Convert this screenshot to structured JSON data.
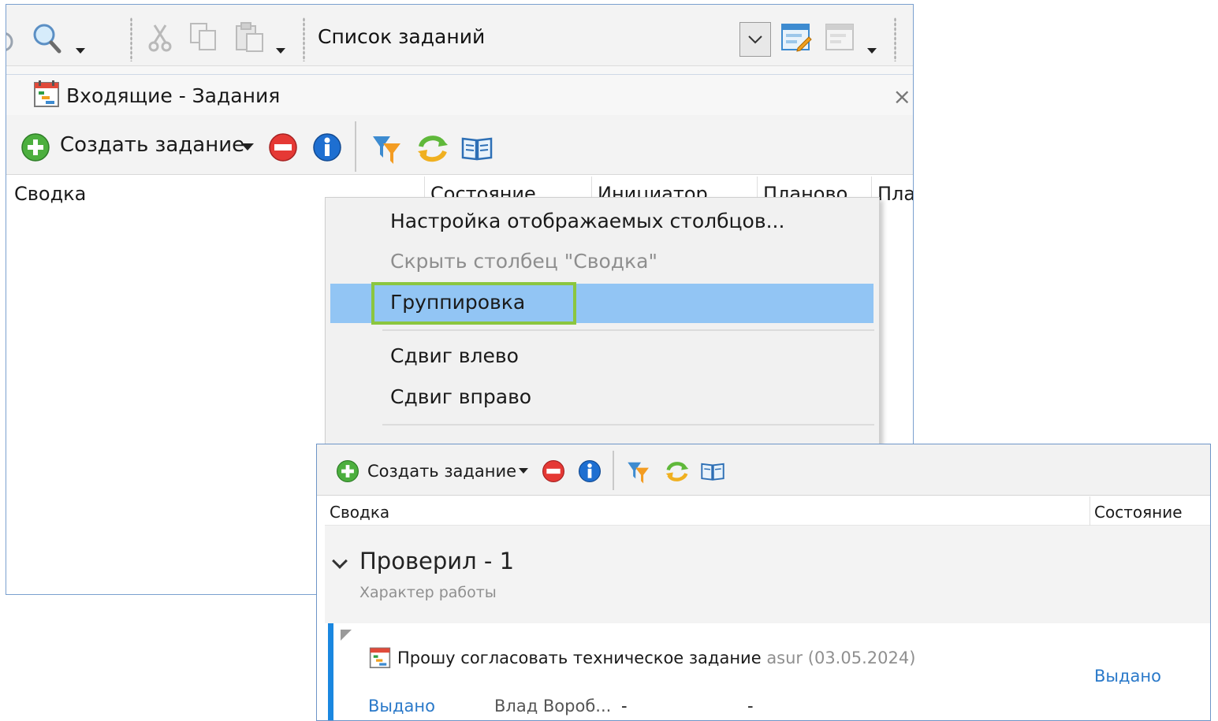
{
  "main_toolbar": {
    "list_selector_value": "Список заданий"
  },
  "tab": {
    "title": "Входящие - Задания",
    "close_glyph": "×"
  },
  "actions": {
    "create_task_label": "Создать задание"
  },
  "table_a": {
    "columns": [
      "Сводка",
      "Состояние",
      "Инициатор",
      "Планово",
      "Пла"
    ]
  },
  "context_menu": {
    "items": [
      {
        "label": "Настройка отображаемых столбцов...",
        "enabled": true
      },
      {
        "label": "Скрыть столбец \"Сводка\"",
        "enabled": false
      },
      {
        "label": "Группировка",
        "enabled": true,
        "highlighted": true
      },
      {
        "label": "Сдвиг влево",
        "enabled": true
      },
      {
        "label": "Сдвиг вправо",
        "enabled": true
      }
    ]
  },
  "front_window": {
    "create_task_label": "Создать задание",
    "columns": [
      "Сводка",
      "Состояние"
    ],
    "group": {
      "title": "Проверил - 1",
      "subtitle": "Характер работы"
    },
    "row": {
      "summary": "Прошу согласовать техническое задание",
      "author": "asur",
      "date": "(03.05.2024)",
      "status": "Выдано",
      "status_left": "Выдано",
      "initiator": "Влад Вороб...",
      "dash1": "-",
      "dash2": "-"
    }
  },
  "colors": {
    "window_border": "#7aa0cf",
    "menu_highlight": "#92c5f4",
    "callout_green": "#8bc63f",
    "row_accent": "#1a87e0",
    "link_blue": "#2a79c9"
  },
  "icons": [
    "search-icon",
    "cut-icon",
    "copy-icon",
    "paste-icon",
    "view-edit-icon",
    "view-icon",
    "calendar-task-icon",
    "add-icon",
    "delete-icon",
    "info-icon",
    "filter-icon",
    "refresh-icon",
    "book-icon"
  ]
}
